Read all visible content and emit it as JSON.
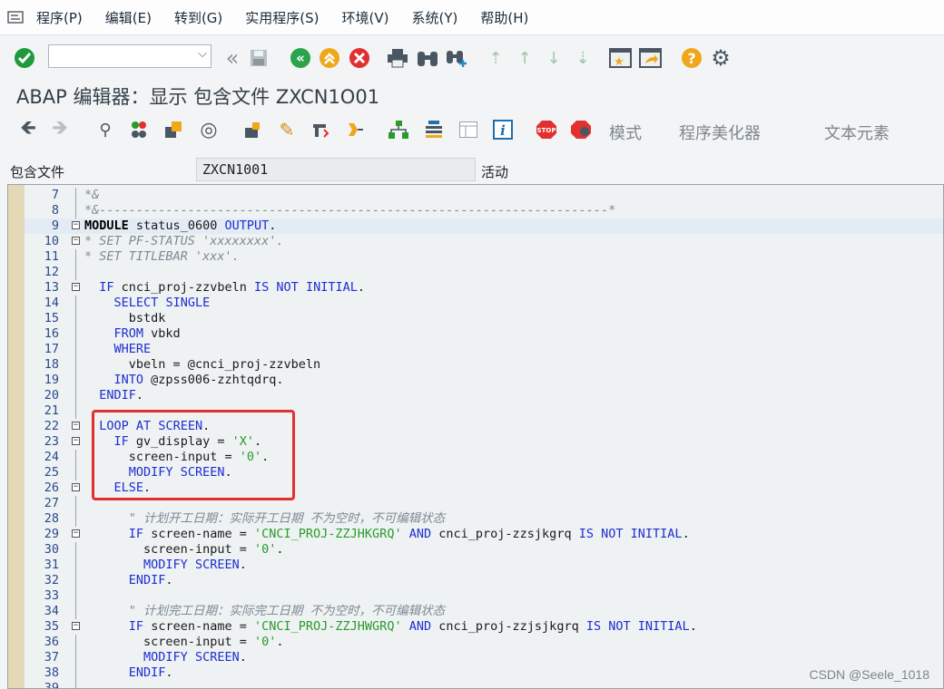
{
  "menu": [
    "程序(P)",
    "编辑(E)",
    "转到(G)",
    "实用程序(S)",
    "环境(V)",
    "系统(Y)",
    "帮助(H)"
  ],
  "command_field": {
    "value": "",
    "placeholder": ""
  },
  "title": "ABAP 编辑器：显示 包含文件 ZXCN1O01",
  "app_toolbar_text": [
    "模式",
    "程序美化器",
    "文本元素"
  ],
  "include": {
    "label": "包含文件",
    "value": "ZXCN1001",
    "status": "活动"
  },
  "code": [
    {
      "n": "7",
      "t": "*&",
      "s": "cm",
      "fold": "",
      "highlight": false
    },
    {
      "n": "8",
      "t": "*&---------------------------------------------------------------------*",
      "s": "cm",
      "fold": "",
      "highlight": false
    },
    {
      "n": "9",
      "t": "MODULE status_0600 OUTPUT.",
      "s": "module",
      "fold": "box",
      "highlight": true
    },
    {
      "n": "10",
      "t": "* SET PF-STATUS 'xxxxxxxx'.",
      "s": "cm",
      "fold": "box",
      "highlight": false
    },
    {
      "n": "11",
      "t": "* SET TITLEBAR 'xxx'.",
      "s": "cm",
      "fold": "",
      "highlight": false
    },
    {
      "n": "12",
      "t": "",
      "s": "tx",
      "fold": "",
      "highlight": false
    },
    {
      "n": "13",
      "t": "  IF cnci_proj-zzvbeln IS NOT INITIAL.",
      "s": "code",
      "fold": "box",
      "highlight": false
    },
    {
      "n": "14",
      "t": "    SELECT SINGLE",
      "s": "code",
      "fold": "",
      "highlight": false
    },
    {
      "n": "15",
      "t": "      bstdk",
      "s": "code",
      "fold": "",
      "highlight": false
    },
    {
      "n": "16",
      "t": "    FROM vbkd",
      "s": "code",
      "fold": "",
      "highlight": false
    },
    {
      "n": "17",
      "t": "    WHERE",
      "s": "code",
      "fold": "",
      "highlight": false
    },
    {
      "n": "18",
      "t": "      vbeln = @cnci_proj-zzvbeln",
      "s": "code",
      "fold": "",
      "highlight": false
    },
    {
      "n": "19",
      "t": "    INTO @zpss006-zzhtqdrq.",
      "s": "code",
      "fold": "",
      "highlight": false
    },
    {
      "n": "20",
      "t": "  ENDIF.",
      "s": "code",
      "fold": "",
      "highlight": false
    },
    {
      "n": "21",
      "t": "",
      "s": "tx",
      "fold": "",
      "highlight": false
    },
    {
      "n": "22",
      "t": "  LOOP AT SCREEN.",
      "s": "code",
      "fold": "box",
      "highlight": false
    },
    {
      "n": "23",
      "t": "    IF gv_display = 'X'.",
      "s": "code",
      "fold": "box",
      "highlight": false
    },
    {
      "n": "24",
      "t": "      screen-input = '0'.",
      "s": "code",
      "fold": "",
      "highlight": false
    },
    {
      "n": "25",
      "t": "      MODIFY SCREEN.",
      "s": "code",
      "fold": "",
      "highlight": false
    },
    {
      "n": "26",
      "t": "    ELSE.",
      "s": "code",
      "fold": "box",
      "highlight": false
    },
    {
      "n": "27",
      "t": "",
      "s": "tx",
      "fold": "",
      "highlight": false
    },
    {
      "n": "28",
      "t": "      \" 计划开工日期：实际开工日期 不为空时，不可编辑状态",
      "s": "cm",
      "fold": "",
      "highlight": false
    },
    {
      "n": "29",
      "t": "      IF screen-name = 'CNCI_PROJ-ZZJHKGRQ' AND cnci_proj-zzsjkgrq IS NOT INITIAL.",
      "s": "code",
      "fold": "box",
      "highlight": false
    },
    {
      "n": "30",
      "t": "        screen-input = '0'.",
      "s": "code",
      "fold": "",
      "highlight": false
    },
    {
      "n": "31",
      "t": "        MODIFY SCREEN.",
      "s": "code",
      "fold": "",
      "highlight": false
    },
    {
      "n": "32",
      "t": "      ENDIF.",
      "s": "code",
      "fold": "",
      "highlight": false
    },
    {
      "n": "33",
      "t": "",
      "s": "tx",
      "fold": "",
      "highlight": false
    },
    {
      "n": "34",
      "t": "      \" 计划完工日期：实际完工日期 不为空时，不可编辑状态",
      "s": "cm",
      "fold": "",
      "highlight": false
    },
    {
      "n": "35",
      "t": "      IF screen-name = 'CNCI_PROJ-ZZJHWGRQ' AND cnci_proj-zzjsjkgrq IS NOT INITIAL.",
      "s": "code",
      "fold": "box",
      "highlight": false
    },
    {
      "n": "36",
      "t": "        screen-input = '0'.",
      "s": "code",
      "fold": "",
      "highlight": false
    },
    {
      "n": "37",
      "t": "        MODIFY SCREEN.",
      "s": "code",
      "fold": "",
      "highlight": false
    },
    {
      "n": "38",
      "t": "      ENDIF.",
      "s": "code",
      "fold": "",
      "highlight": false
    },
    {
      "n": "39",
      "t": "",
      "s": "tx",
      "fold": "",
      "highlight": false
    }
  ],
  "keywords": [
    "MODULE",
    "OUTPUT",
    "IF",
    "IS",
    "NOT",
    "INITIAL",
    "SELECT",
    "SINGLE",
    "FROM",
    "WHERE",
    "INTO",
    "ENDIF",
    "LOOP",
    "AT",
    "SCREEN",
    "MODIFY",
    "ELSE",
    "AND"
  ],
  "watermark": "CSDN @Seele_1018",
  "colors": {
    "keyword": "#1e2ed0",
    "comment": "#7e8a94",
    "string": "#2a9a2a",
    "annotation_box": "#e23030"
  }
}
